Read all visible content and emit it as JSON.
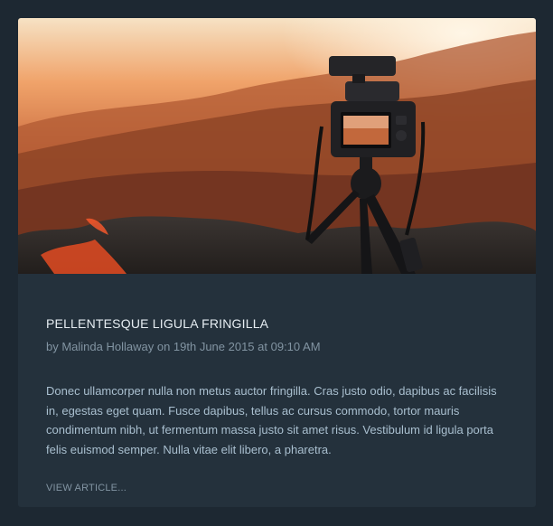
{
  "article": {
    "image_alt_icon": "camera-photo",
    "title": "PELLENTESQUE LIGULA FRINGILLA",
    "meta": "by Malinda Hollaway on 19th June 2015 at 09:10 AM",
    "excerpt": "Donec ullamcorper nulla non metus auctor fringilla. Cras justo odio, dapibus ac facilisis in, egestas eget quam. Fusce dapibus, tellus ac cursus commodo, tortor mauris condimentum nibh, ut fermentum massa justo sit amet risus. Vestibulum id ligula porta felis euismod semper. Nulla vitae elit libero, a pharetra.",
    "read_more_label": "VIEW ARTICLE..."
  },
  "colors": {
    "page_bg": "#1d2832",
    "card_bg": "#24313c",
    "title": "#e6edf2",
    "meta": "#8294a2",
    "text": "#a9bfcf"
  }
}
